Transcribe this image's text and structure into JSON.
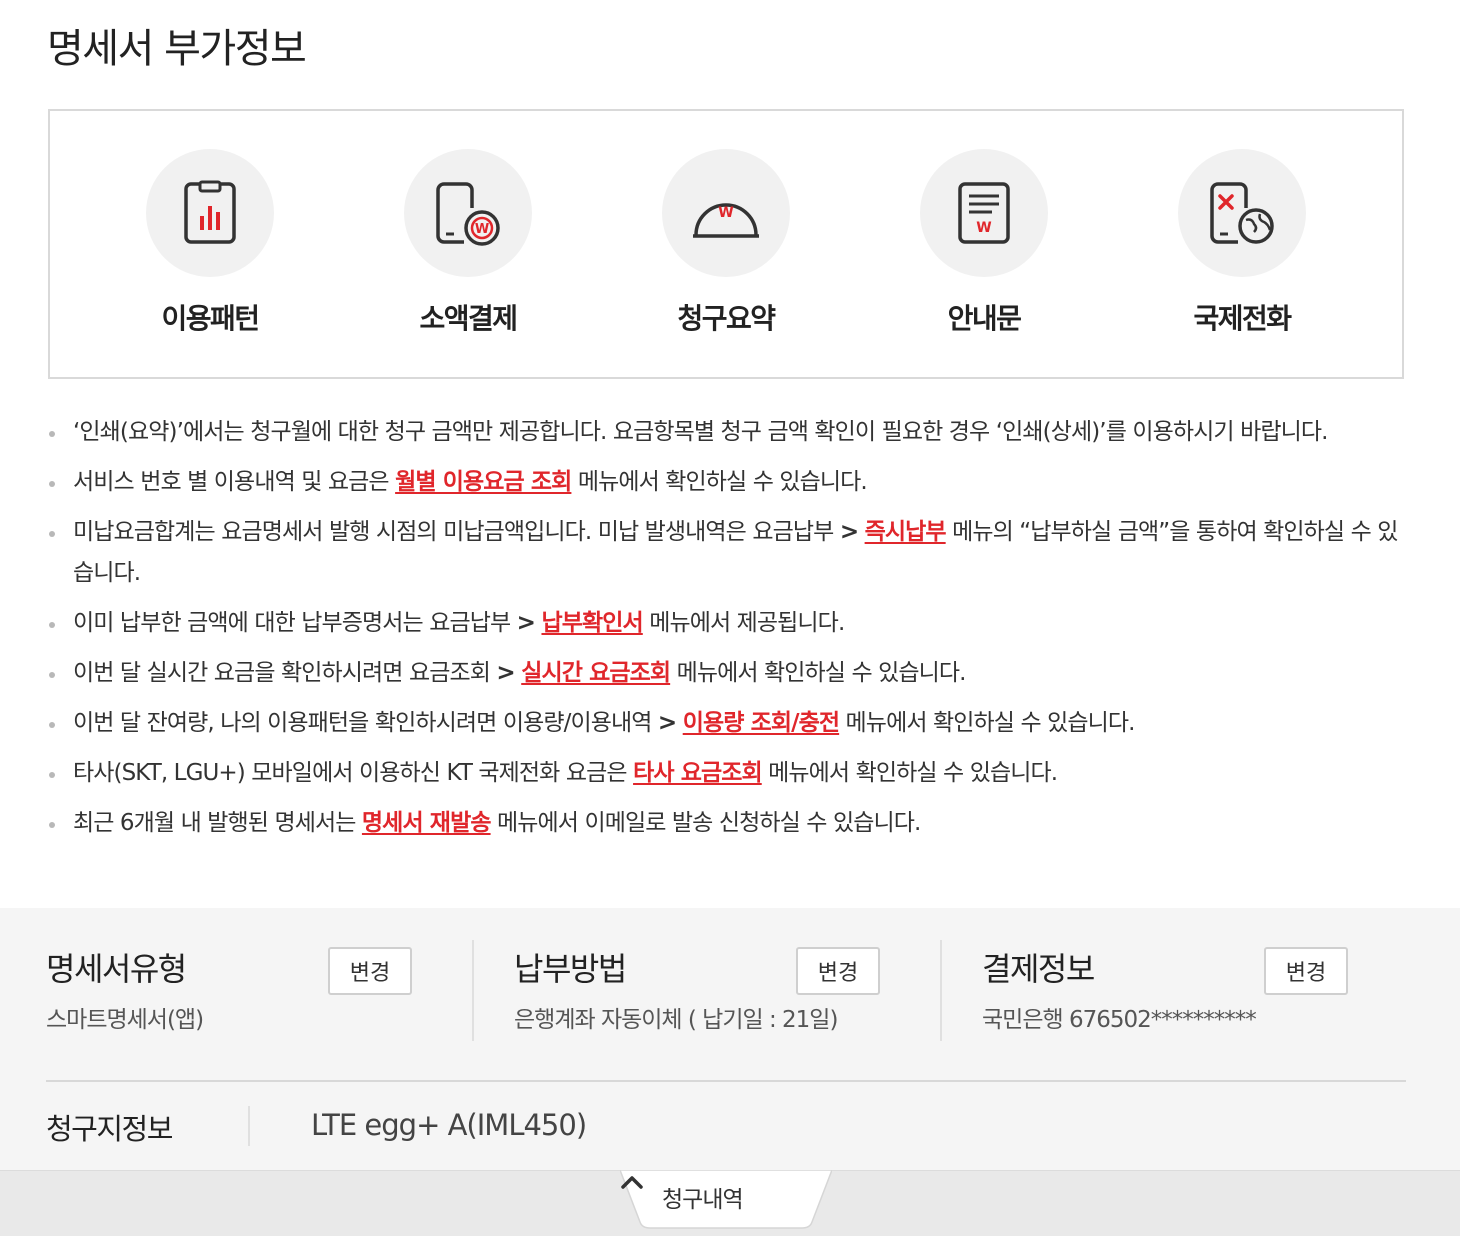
{
  "page_title": "명세서 부가정보",
  "menu": [
    {
      "label": "이용패턴",
      "icon": "usage-pattern-icon"
    },
    {
      "label": "소액결제",
      "icon": "micropayment-icon"
    },
    {
      "label": "청구요약",
      "icon": "billing-summary-icon"
    },
    {
      "label": "안내문",
      "icon": "notice-icon"
    },
    {
      "label": "국제전화",
      "icon": "international-call-icon"
    }
  ],
  "notices": [
    {
      "text": "‘인쇄(요약)’에서는 청구월에 대한 청구 금액만 제공합니다. 요금항목별 청구 금액 확인이 필요한 경우 ‘인쇄(상세)’를 이용하시기 바랍니다."
    },
    {
      "before": "서비스 번호 별 이용내역 및 요금은 ",
      "link": "월별 이용요금 조회",
      "after": " 메뉴에서 확인하실 수 있습니다."
    },
    {
      "before": "미납요금합계는 요금명세서 발행 시점의 미납금액입니다. 미납 발생내역은 요금납부 ",
      "gt": ">",
      "link": "즉시납부",
      "after": " 메뉴의 “납부하실 금액”을 통하여 확인하실 수 있습니다."
    },
    {
      "before": "이미 납부한 금액에 대한 납부증명서는 요금납부 ",
      "gt": ">",
      "link": "납부확인서",
      "after": " 메뉴에서 제공됩니다."
    },
    {
      "before": "이번 달 실시간 요금을 확인하시려면 요금조회 ",
      "gt": ">",
      "link": "실시간 요금조회",
      "after": " 메뉴에서 확인하실 수 있습니다."
    },
    {
      "before": "이번 달 잔여량, 나의 이용패턴을 확인하시려면 이용량/이용내역 ",
      "gt": ">",
      "link": "이용량 조회/충전",
      "after": " 메뉴에서 확인하실 수 있습니다."
    },
    {
      "before": "타사(SKT, LGU+) 모바일에서 이용하신 KT 국제전화 요금은 ",
      "link": "타사 요금조회",
      "after": " 메뉴에서 확인하실 수 있습니다."
    },
    {
      "before": "최근 6개월 내 발행된 명세서는 ",
      "link": "명세서 재발송",
      "after": " 메뉴에서 이메일로 발송 신청하실 수 있습니다."
    }
  ],
  "info": {
    "statement_type": {
      "title": "명세서유형",
      "value": "스마트명세서(앱)",
      "button": "변경"
    },
    "payment_method": {
      "title": "납부방법",
      "value": "은행계좌 자동이체 ( 납기일 : 21일)",
      "button": "변경"
    },
    "payment_info": {
      "title": "결제정보",
      "value": "국민은행 676502**********",
      "button": "변경"
    }
  },
  "billing": {
    "title": "청구지정보",
    "plan": "LTE egg+ A(IML450)"
  },
  "bottom_tab": {
    "label": "청구내역",
    "icon": "chevron-up-icon"
  },
  "colors": {
    "accent_red": "#e0262b",
    "icon_red": "#e0262b",
    "icon_dark": "#333333",
    "panel_bg": "#f5f5f5"
  }
}
